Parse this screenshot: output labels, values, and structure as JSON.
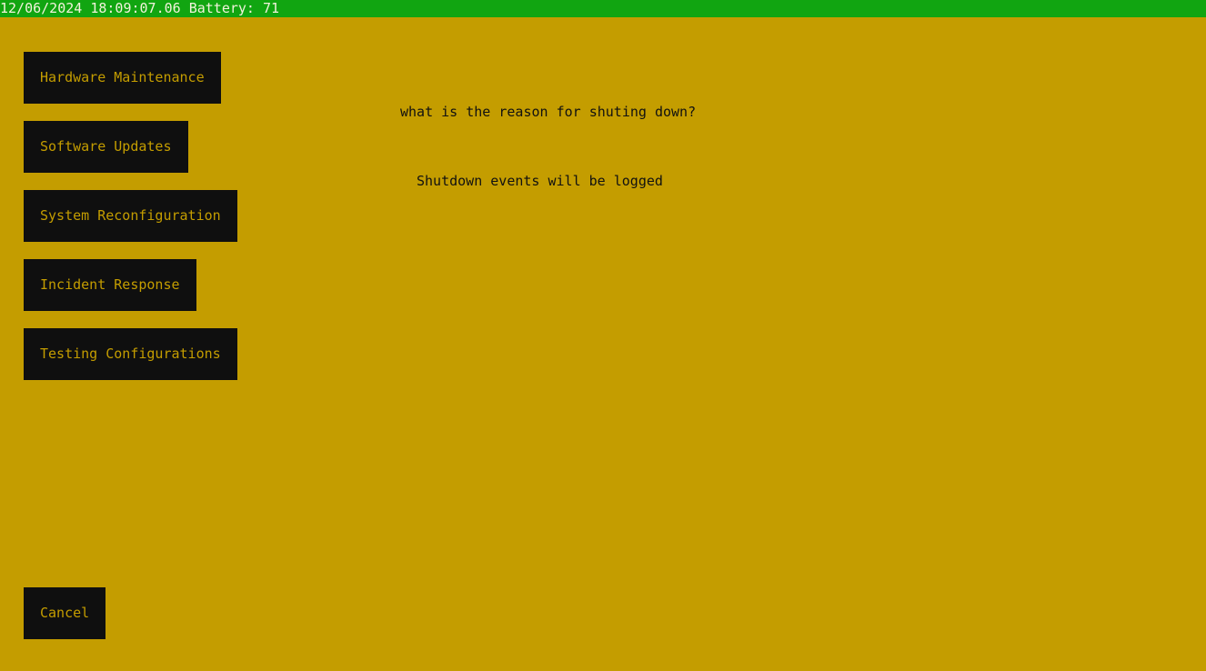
{
  "status_bar": {
    "text": "12/06/2024 18:09:07.06 Battery: 71"
  },
  "dialog": {
    "prompt": "what is the reason for shuting down?",
    "note": "Shutdown events will be logged"
  },
  "reasons": [
    "Hardware Maintenance",
    "Software Updates",
    "System Reconfiguration",
    "Incident Response",
    "Testing Configurations"
  ],
  "cancel_label": "Cancel",
  "colors": {
    "background": "#c49d00",
    "status_bar": "#11a511",
    "button_bg": "#0f0f0f",
    "button_text": "#c49d00"
  }
}
